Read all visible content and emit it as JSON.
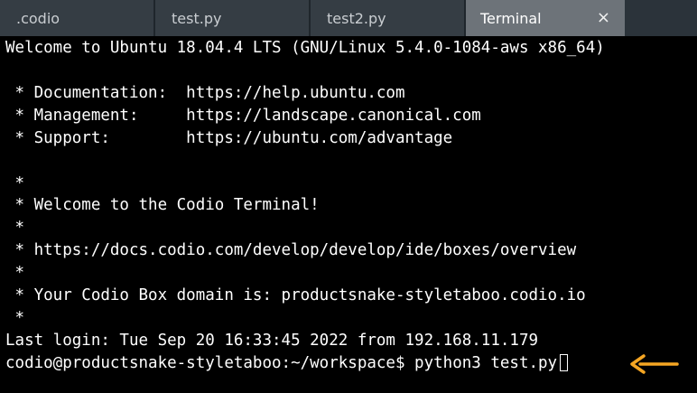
{
  "tabs": [
    {
      "label": ".codio"
    },
    {
      "label": "test.py"
    },
    {
      "label": "test2.py"
    },
    {
      "label": "Terminal",
      "close": "×"
    }
  ],
  "terminal": {
    "lines": [
      "Welcome to Ubuntu 18.04.4 LTS (GNU/Linux 5.4.0-1084-aws x86_64)",
      " * Documentation:  https://help.ubuntu.com",
      " * Management:     https://landscape.canonical.com",
      " * Support:        https://ubuntu.com/advantage",
      " *",
      " * Welcome to the Codio Terminal!",
      " *",
      " * https://docs.codio.com/develop/develop/ide/boxes/overview",
      " *",
      " * Your Codio Box domain is: productsnake-styletaboo.codio.io",
      " *",
      "Last login: Tue Sep 20 16:33:45 2022 from 192.168.11.179"
    ],
    "prompt": "codio@productsnake-styletaboo:~/workspace$ ",
    "command": "python3 test.py"
  },
  "colors": {
    "arrow": "#f5a623",
    "active_tab": "#6d7379",
    "tab": "#353d44"
  },
  "icons": {
    "arrow": "arrow-left-icon",
    "close": "close-icon"
  }
}
